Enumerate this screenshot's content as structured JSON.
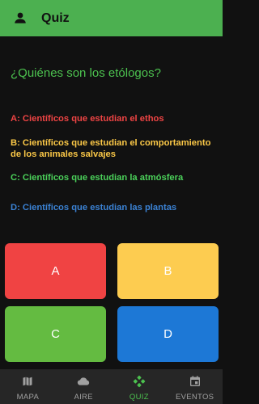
{
  "appbar": {
    "title": "Quiz",
    "icon": "person-icon"
  },
  "question": "¿Quiénes son los etólogos?",
  "options": [
    {
      "text": "A:  Científicos que estudian el ethos",
      "color": "#ef4444"
    },
    {
      "text": "B:  Científicos que estudian el comportamiento de los animales salvajes",
      "color": "#fbc847"
    },
    {
      "text": "C:  Científicos que estudian la atmósfera",
      "color": "#4bd15a"
    },
    {
      "text": "D:  Científicos que estudian las plantas",
      "color": "#3b82d4"
    }
  ],
  "answers": [
    {
      "label": "A",
      "color": "#f04343"
    },
    {
      "label": "B",
      "color": "#fdcc50"
    },
    {
      "label": "C",
      "color": "#64bb41"
    },
    {
      "label": "D",
      "color": "#1d78d6"
    }
  ],
  "nav": {
    "items": [
      {
        "label": "MAPA",
        "icon": "map-icon"
      },
      {
        "label": "AIRE",
        "icon": "cloud-icon"
      },
      {
        "label": "QUIZ",
        "icon": "gamepad-icon",
        "active": true
      },
      {
        "label": "EVENTOS",
        "icon": "calendar-icon"
      }
    ],
    "active_color": "#4cc24f"
  }
}
